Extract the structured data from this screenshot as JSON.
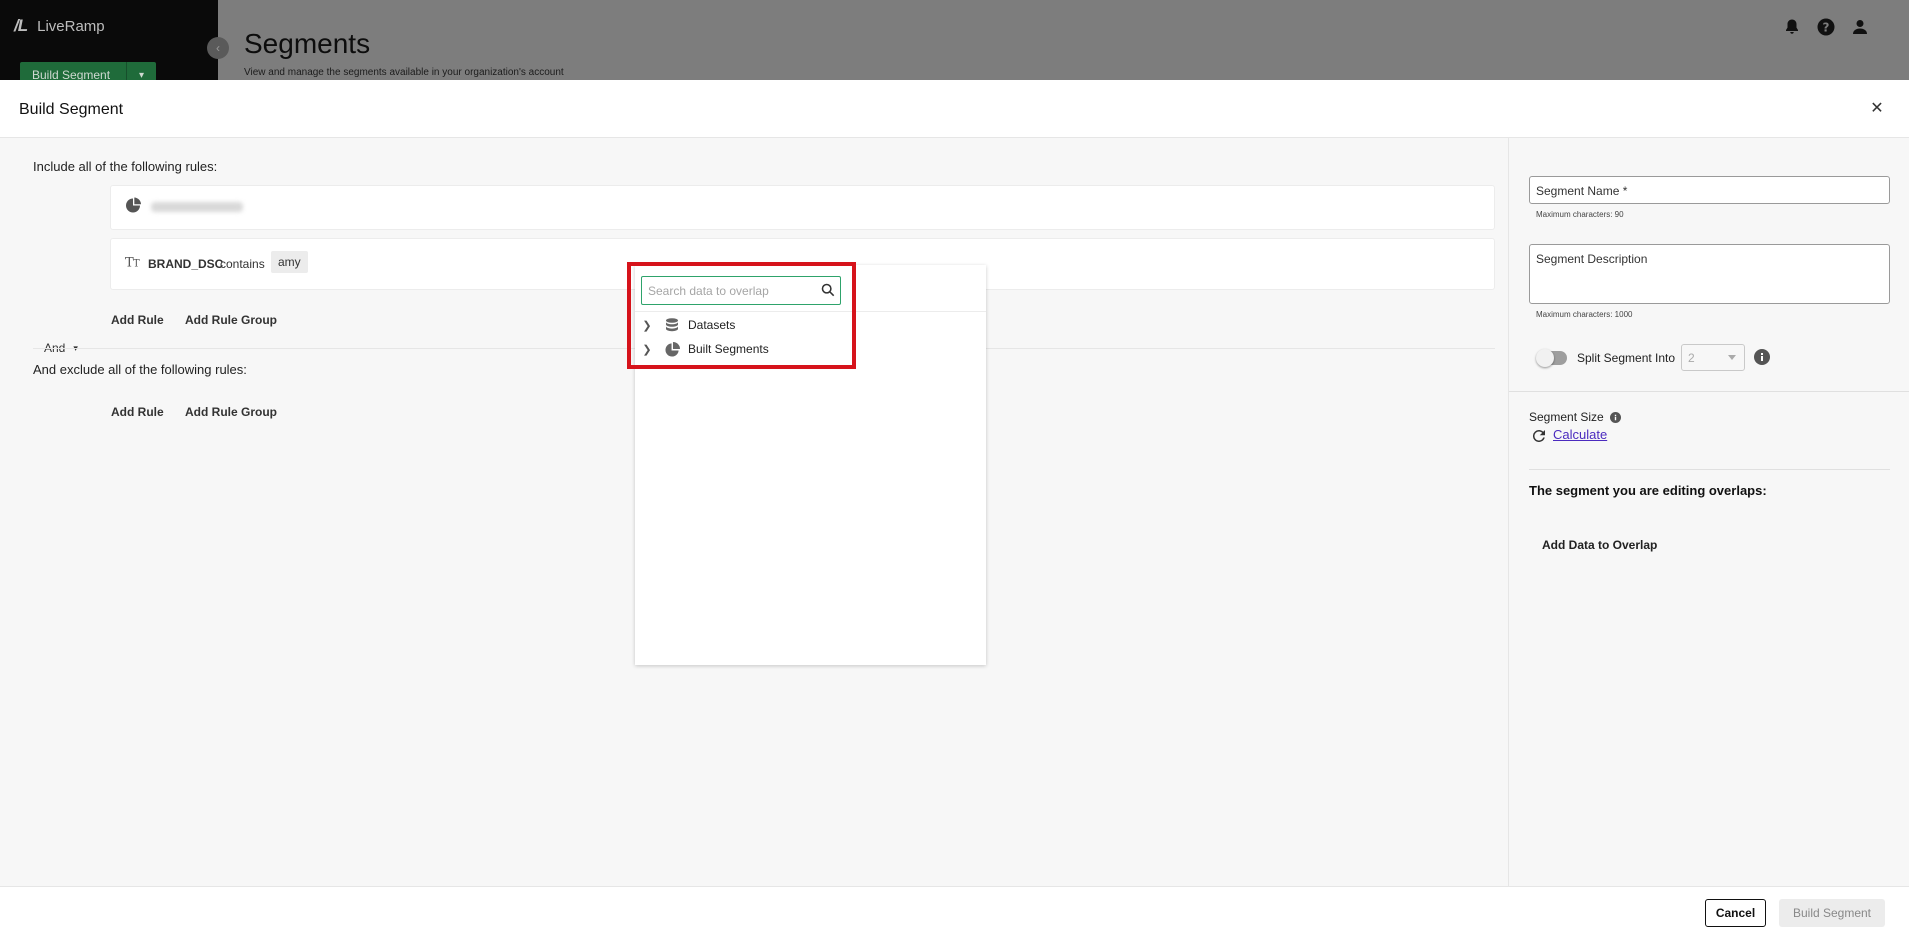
{
  "app": {
    "logo_mark": "/L",
    "logo_text": "LiveRamp",
    "build_button": "Build Segment",
    "page_title": "Segments",
    "page_subtitle": "View and manage the segments available in your organization's account"
  },
  "modal": {
    "title": "Build Segment",
    "include_label": "Include all of the following rules:",
    "exclude_label": "And exclude all of the following rules:",
    "and_label": "And",
    "rule": {
      "field": "BRAND_DSC",
      "operator": "contains",
      "value": "amy"
    },
    "add_rule": "Add Rule",
    "add_rule_group": "Add Rule Group"
  },
  "dropdown": {
    "search_placeholder": "Search data to overlap",
    "items": [
      {
        "label": "Datasets",
        "icon": "database-icon"
      },
      {
        "label": "Built Segments",
        "icon": "pie-chart-icon"
      }
    ]
  },
  "right_panel": {
    "segment_name_label": "Segment Name *",
    "segment_name_hint": "Maximum characters: 90",
    "segment_description_label": "Segment Description",
    "segment_description_hint": "Maximum characters: 1000",
    "split_label": "Split Segment Into",
    "split_value": "2",
    "segment_size_label": "Segment Size",
    "calculate_label": "Calculate",
    "overlap_title": "The segment you are editing overlaps:",
    "add_overlap": "Add Data to Overlap"
  },
  "footer": {
    "cancel": "Cancel",
    "build": "Build Segment"
  },
  "colors": {
    "highlight": "#d6131b",
    "search_border": "#2ea36b",
    "link": "#4b2bbf"
  }
}
